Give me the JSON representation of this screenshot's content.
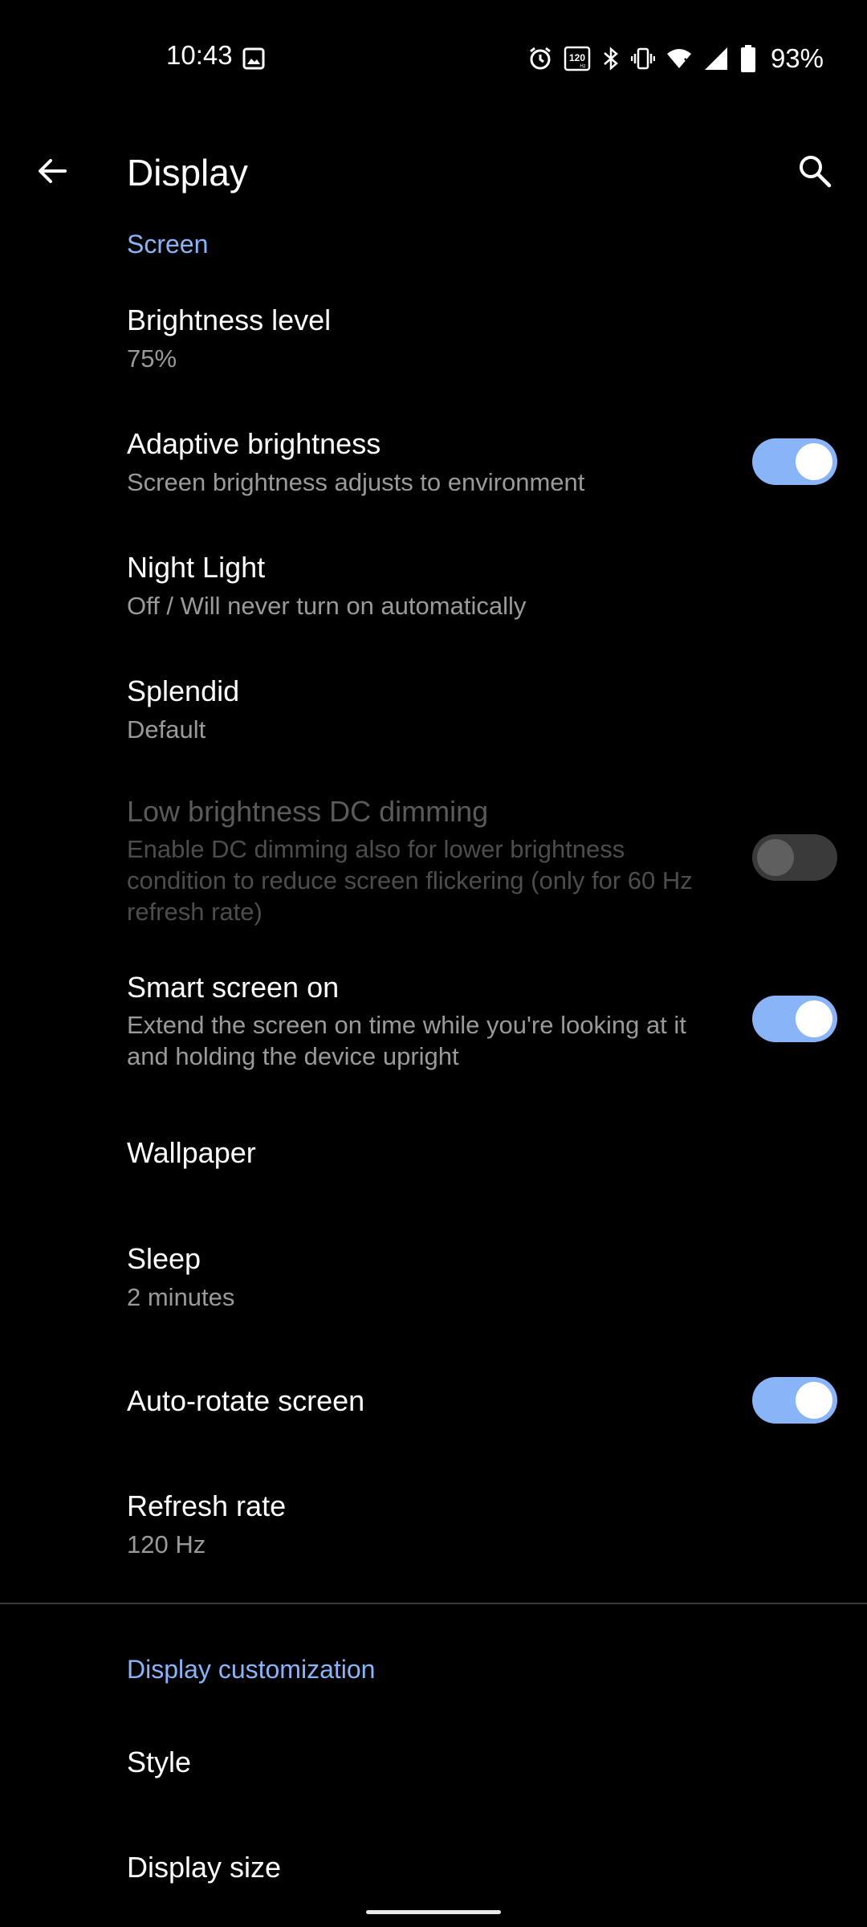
{
  "status_bar": {
    "time": "10:43",
    "battery_percent": "93%",
    "refresh_badge": "120",
    "icons": [
      "gallery-icon",
      "alarm-icon",
      "refresh-rate-icon",
      "bluetooth-icon",
      "vibrate-icon",
      "wifi-icon",
      "signal-icon",
      "battery-icon"
    ]
  },
  "app_bar": {
    "title": "Display",
    "back_icon": "arrow-back-icon",
    "search_icon": "search-icon"
  },
  "sections": {
    "screen": "Screen",
    "customization": "Display customization"
  },
  "items": {
    "brightness": {
      "title": "Brightness level",
      "summary": "75%"
    },
    "adaptive": {
      "title": "Adaptive brightness",
      "summary": "Screen brightness adjusts to environment",
      "toggle": "on"
    },
    "night_light": {
      "title": "Night Light",
      "summary": "Off / Will never turn on automatically"
    },
    "splendid": {
      "title": "Splendid",
      "summary": "Default"
    },
    "dc_dimming": {
      "title": "Low brightness DC dimming",
      "summary": "Enable DC dimming also for lower brightness condition to reduce screen flickering (only for 60 Hz refresh rate)",
      "toggle": "off",
      "enabled": false
    },
    "smart_screen": {
      "title": "Smart screen on",
      "summary": "Extend the screen on time while you're looking at it and holding the device upright",
      "toggle": "on"
    },
    "wallpaper": {
      "title": "Wallpaper"
    },
    "sleep": {
      "title": "Sleep",
      "summary": "2 minutes"
    },
    "auto_rotate": {
      "title": "Auto-rotate screen",
      "toggle": "on"
    },
    "refresh_rate": {
      "title": "Refresh rate",
      "summary": "120 Hz"
    },
    "style": {
      "title": "Style"
    },
    "display_size": {
      "title": "Display size"
    }
  },
  "colors": {
    "accent": "#8AB4F8",
    "background": "#000000",
    "secondary_text": "#9a9a9a"
  }
}
